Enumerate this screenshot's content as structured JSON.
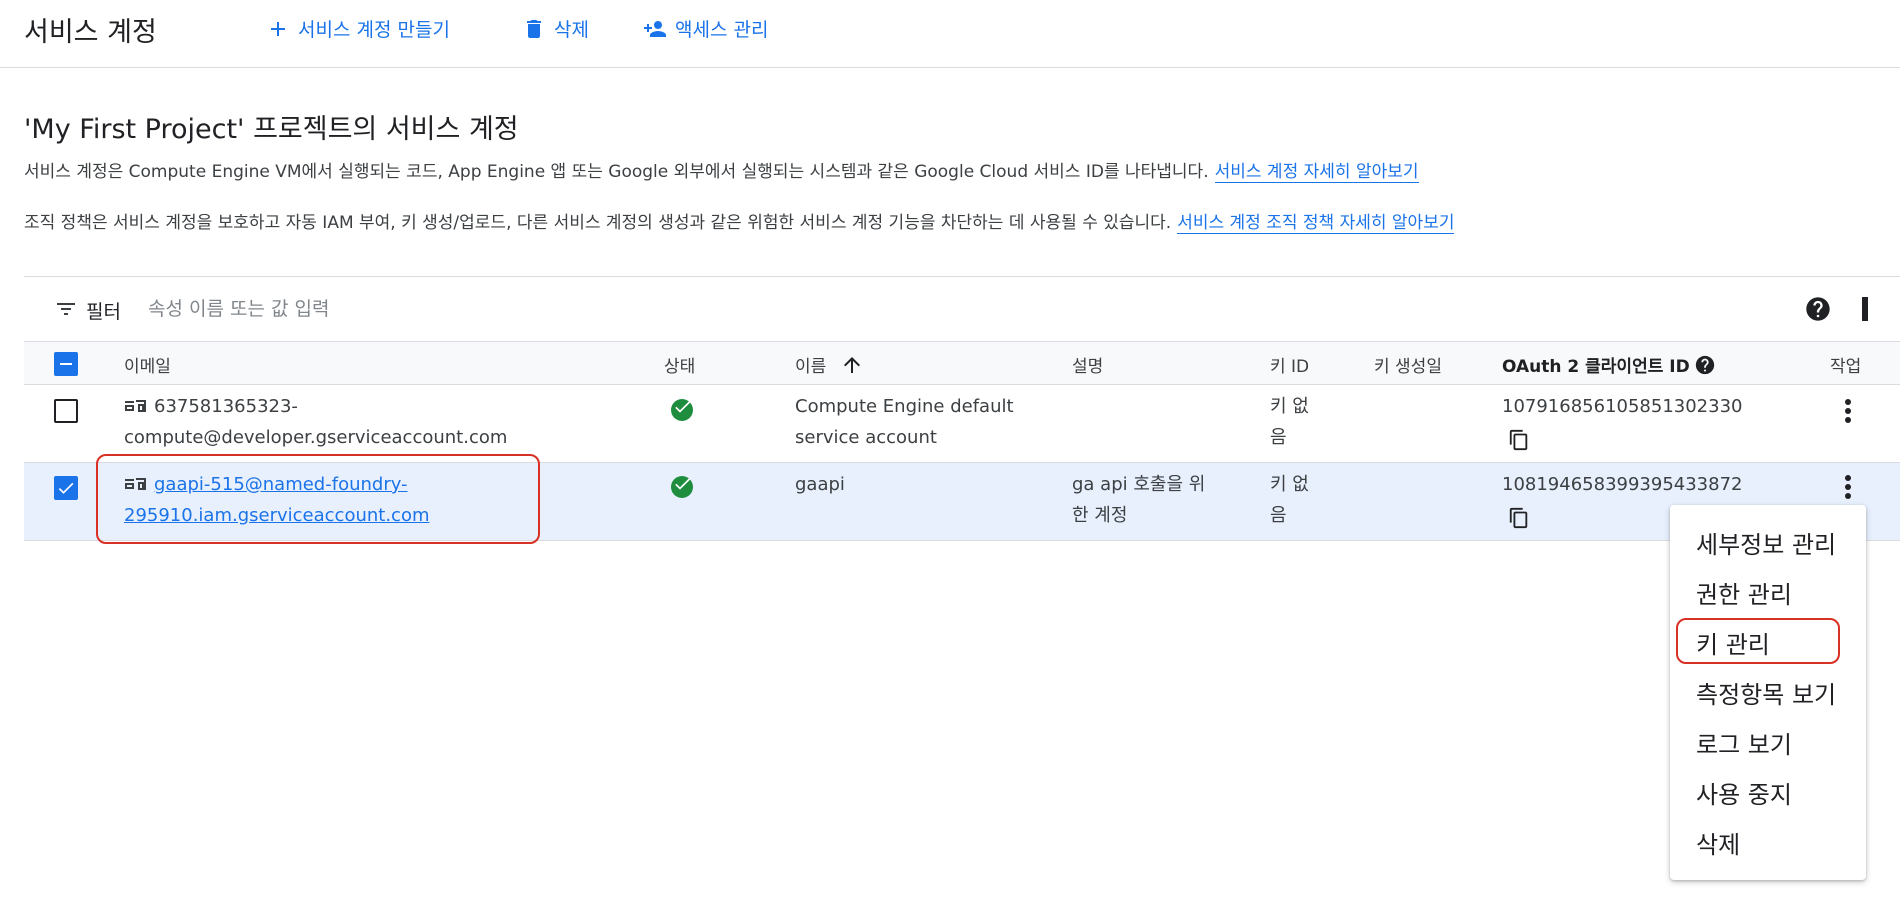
{
  "header": {
    "title": "서비스 계정",
    "create_label": "서비스 계정 만들기",
    "delete_label": "삭제",
    "access_label": "액세스 관리"
  },
  "intro": {
    "heading": "'My First Project' 프로젝트의 서비스 계정",
    "desc1": "서비스 계정은 Compute Engine VM에서 실행되는 코드, App Engine 앱 또는 Google 외부에서 실행되는 시스템과 같은 Google Cloud 서비스 ID를 나타냅니다.",
    "link1": "서비스 계정 자세히 알아보기",
    "desc2": "조직 정책은 서비스 계정을 보호하고 자동 IAM 부여, 키 생성/업로드, 다른 서비스 계정의 생성과 같은 위험한 서비스 계정 기능을 차단하는 데 사용될 수 있습니다.",
    "link2": "서비스 계정 조직 정책 자세히 알아보기"
  },
  "filter": {
    "label": "필터",
    "placeholder": "속성 이름 또는 값 입력"
  },
  "table": {
    "headers": {
      "email": "이메일",
      "status": "상태",
      "name": "이름",
      "description": "설명",
      "key_id": "키 ID",
      "key_created": "키 생성일",
      "oauth": "OAuth 2 클라이언트 ID",
      "actions": "작업"
    },
    "rows": [
      {
        "email_line1": "637581365323-",
        "email_line2": "compute@developer.gserviceaccount.com",
        "name_line1": "Compute Engine default",
        "name_line2": "service account",
        "desc_line1": "",
        "desc_line2": "",
        "key_line1": "키 없",
        "key_line2": "음",
        "oauth_id": "107916856105851302330",
        "selected": false
      },
      {
        "email_line1": "gaapi-515@named-foundry-",
        "email_line2": "295910.iam.gserviceaccount.com",
        "name_line1": "gaapi",
        "name_line2": "",
        "desc_line1": "ga api 호출을 위",
        "desc_line2": "한 계정",
        "key_line1": "키 없",
        "key_line2": "음",
        "oauth_id": "108194658399395433872",
        "selected": true
      }
    ]
  },
  "menu": {
    "items": [
      "세부정보 관리",
      "권한 관리",
      "키 관리",
      "측정항목 보기",
      "로그 보기",
      "사용 중지",
      "삭제"
    ]
  },
  "colors": {
    "accent": "#1a73e8",
    "success": "#1e8e3e",
    "highlight": "#d93025"
  }
}
